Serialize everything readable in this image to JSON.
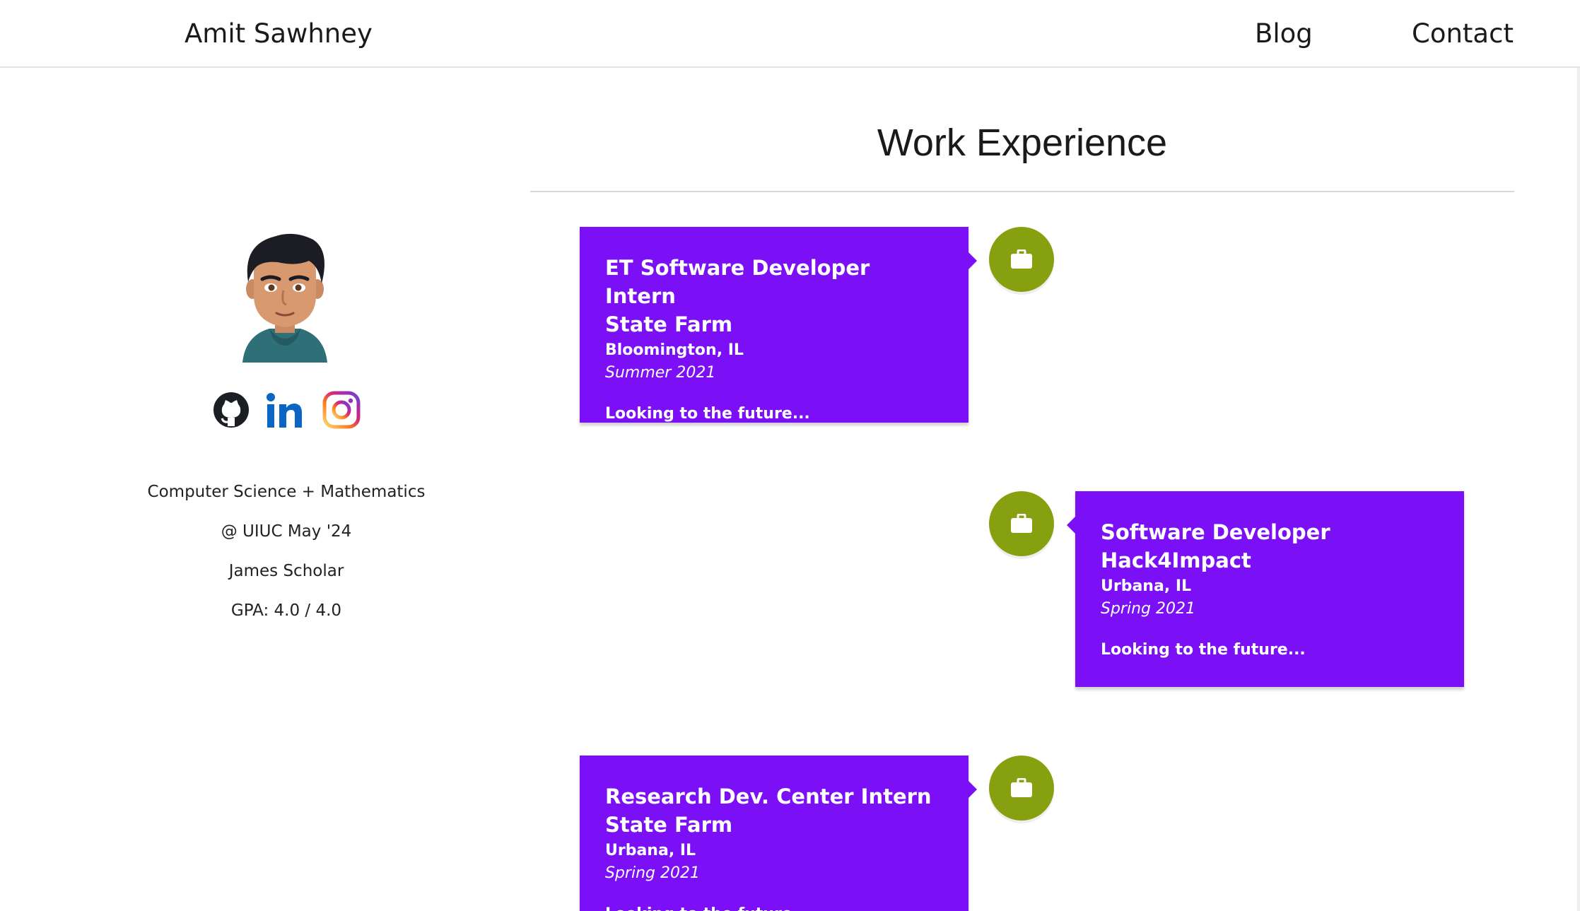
{
  "navbar": {
    "brand": "Amit Sawhney",
    "links": [
      "Blog",
      "Contact"
    ]
  },
  "sidebar": {
    "social_icons": [
      "github-icon",
      "linkedin-icon",
      "instagram-icon"
    ],
    "bio": [
      "Computer Science + Mathematics",
      "@ UIUC May '24",
      "James Scholar",
      "GPA: 4.0 / 4.0"
    ]
  },
  "main": {
    "title": "Work Experience",
    "experiences": [
      {
        "role": "ET Software Developer Intern",
        "company": "State Farm",
        "location": "Bloomington, IL",
        "date": "Summer 2021",
        "description": "Looking to the future..."
      },
      {
        "role": "Software Developer",
        "company": "Hack4Impact",
        "location": "Urbana, IL",
        "date": "Spring 2021",
        "description": "Looking to the future..."
      },
      {
        "role": "Research Dev. Center Intern",
        "company": "State Farm",
        "location": "Urbana, IL",
        "date": "Spring 2021",
        "description": "Looking to the future..."
      }
    ]
  },
  "colors": {
    "card_background": "#7b0ff5",
    "timeline_dot": "#86a00f",
    "linkedin": "#0a66c2"
  }
}
